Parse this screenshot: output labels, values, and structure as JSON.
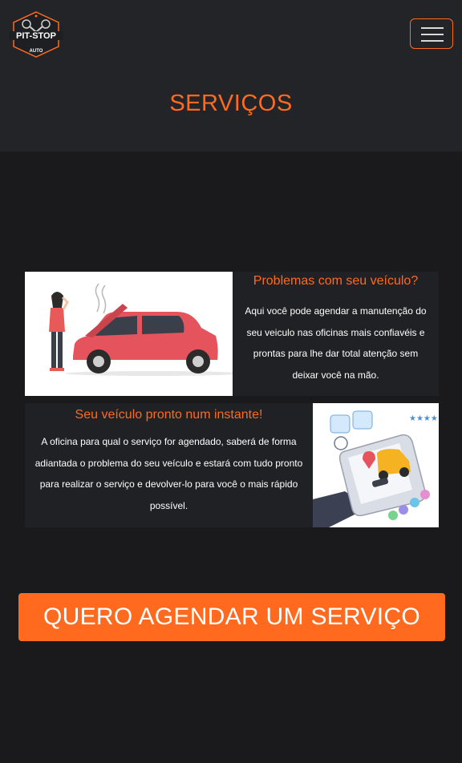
{
  "header": {
    "logo": {
      "text_top": "PIT-STOP",
      "text_bottom": "AUTO"
    },
    "menu_icon": "hamburger-icon"
  },
  "page": {
    "title": "SERVIÇOS"
  },
  "banners": [
    {
      "heading": "Problemas com seu veículo?",
      "body": "Aqui você pode agendar a manutenção do seu veiculo nas oficinas mais confiavéis e prontas para lhe dar total atenção sem deixar você na mão.",
      "illustration": "woman-with-broken-car-illustration"
    },
    {
      "heading": "Seu veículo pronto num instante!",
      "body": "A oficina para qual o serviço for agendado, saberá de forma adiantada o problema do seu veículo e estará com tudo pronto para realizar o serviço e devolver-lo para você o mais rápido possível.",
      "illustration": "phone-with-car-app-illustration"
    }
  ],
  "cta": {
    "label": "QUERO AGENDAR UM SERVIÇO"
  },
  "colors": {
    "accent": "#ff6a1f",
    "header_bg": "#222428",
    "page_bg": "#1a1a1c",
    "banner_bg": "#1f2124"
  }
}
